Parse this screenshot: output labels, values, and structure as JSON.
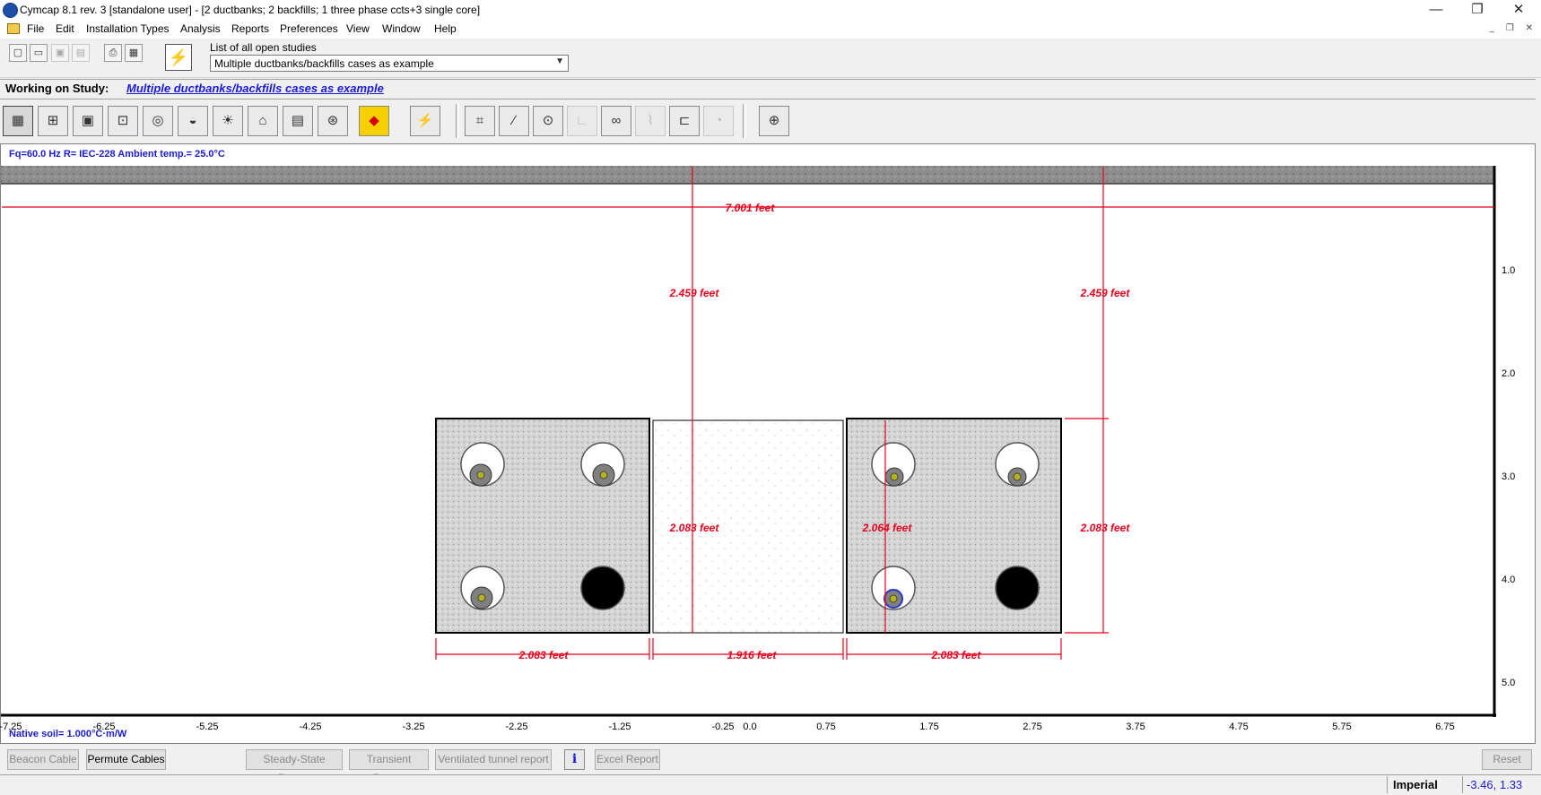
{
  "window": {
    "title": "Cymcap 8.1 rev. 3 [standalone user] - [2 ductbanks; 2 backfills; 1 three phase ccts+3 single core]",
    "minimize": "—",
    "restore": "❐",
    "close": "✕"
  },
  "menu": {
    "items": [
      "File",
      "Edit",
      "Installation Types",
      "Analysis",
      "Reports",
      "Preferences",
      "View",
      "Window",
      "Help"
    ]
  },
  "toolbar": {
    "study_list_label": "List of all open studies",
    "study_selected": "Multiple ductbanks/backfills cases as example"
  },
  "working": {
    "label": "Working on Study:",
    "study_link": "Multiple ductbanks/backfills cases as example"
  },
  "canvas": {
    "info": "Fq=60.0 Hz  R= IEC-228     Ambient temp.= 25.0°C",
    "native_soil": "Native soil= 1.000°C·m/W",
    "x_ticks": [
      "-7.25",
      "-6.25",
      "-5.25",
      "-4.25",
      "-3.25",
      "-2.25",
      "-1.25",
      "-0.25",
      "0.0",
      "0.75",
      "1.75",
      "2.75",
      "3.75",
      "4.75",
      "5.75",
      "6.75"
    ],
    "y_ticks": [
      "1.0",
      "2.0",
      "3.0",
      "4.0",
      "5.0"
    ],
    "dim_total_width": "7.001 feet",
    "dim_depth_left": "2.459 feet",
    "dim_depth_right": "2.459 feet",
    "dim_height_backfill": "2.083 feet",
    "dim_height_cable": "2.064 feet",
    "dim_height_right": "2.083 feet",
    "dim_width_left_bank": "2.083 feet",
    "dim_width_backfill": "1.916 feet",
    "dim_width_right_bank": "2.083 feet"
  },
  "buttons": {
    "beacon": "Beacon Cable",
    "permute": "Permute Cables",
    "steady": "Steady-State Report",
    "transient": "Transient Report",
    "ventilated": "Ventilated tunnel report",
    "info": "i",
    "excel": "Excel Report",
    "reset": "Reset"
  },
  "status": {
    "units": "Imperial",
    "coords": "-3.46, 1.33"
  },
  "colors": {
    "dimension": "#e8001c",
    "link": "#1a1ad6",
    "soil": "#d6d6d6"
  }
}
